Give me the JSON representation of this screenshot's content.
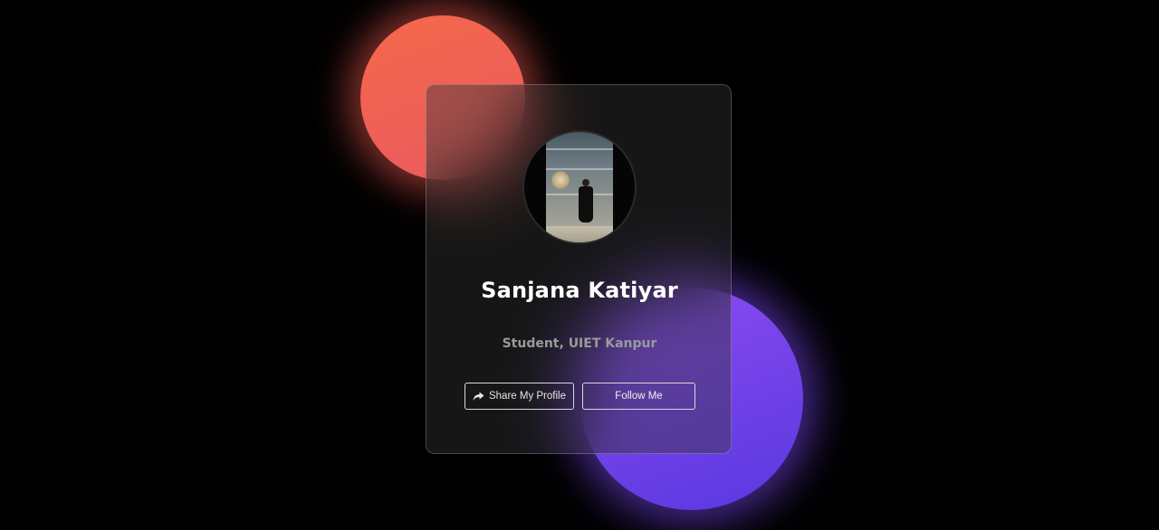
{
  "profile": {
    "name": "Sanjana Katiyar",
    "role": "Student, UIET Kanpur"
  },
  "actions": {
    "share_label": "Share My Profile",
    "follow_label": "Follow Me"
  },
  "icons": {
    "share": "share-arrow-icon"
  },
  "colors": {
    "background": "#000000",
    "coral_blob": "#f0604f",
    "violet_blob": "#7a45ea",
    "name_text": "#ffffff",
    "role_text": "#9a9a9a",
    "button_border": "#d8d8d8"
  }
}
